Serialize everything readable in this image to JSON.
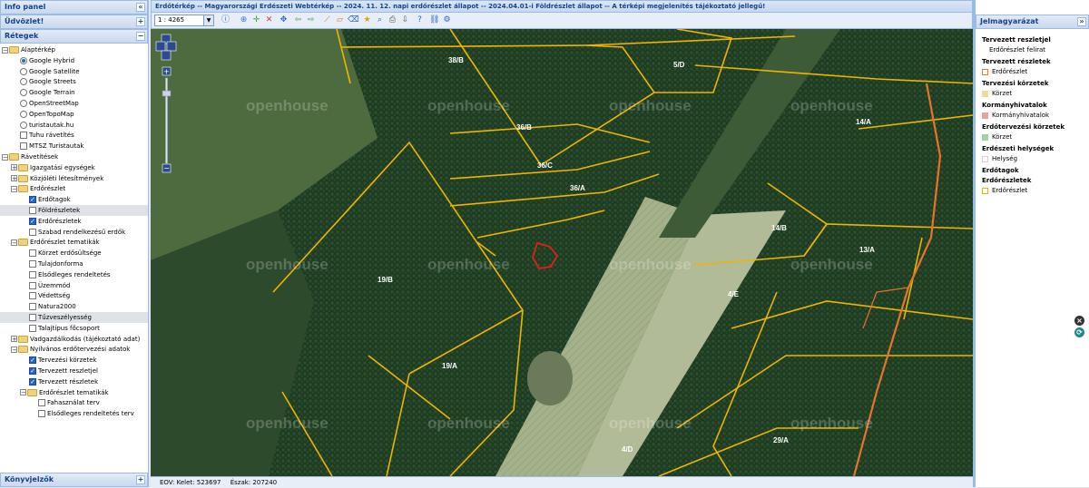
{
  "left_panel": {
    "info_title": "Info panel",
    "welcome_title": "Üdvözlet!",
    "layers_title": "Rétegek",
    "bookmarks_title": "Könyvjelzők",
    "tree": [
      {
        "label": "Alaptérkép",
        "indent": 0,
        "kind": "folder",
        "expanded": true
      },
      {
        "label": "Google Hybrid",
        "indent": 2,
        "kind": "radio",
        "checked": true
      },
      {
        "label": "Google Satellite",
        "indent": 2,
        "kind": "radio",
        "checked": false
      },
      {
        "label": "Google Streets",
        "indent": 2,
        "kind": "radio",
        "checked": false
      },
      {
        "label": "Google Terrain",
        "indent": 2,
        "kind": "radio",
        "checked": false
      },
      {
        "label": "OpenStreetMap",
        "indent": 2,
        "kind": "radio",
        "checked": false
      },
      {
        "label": "OpenTopoMap",
        "indent": 2,
        "kind": "radio",
        "checked": false
      },
      {
        "label": "turistautak.hu",
        "indent": 2,
        "kind": "radio",
        "checked": false
      },
      {
        "label": "Tuhu rávetítés",
        "indent": 2,
        "kind": "checkbox",
        "checked": false
      },
      {
        "label": "MTSZ Turistautak",
        "indent": 2,
        "kind": "checkbox",
        "checked": false
      },
      {
        "label": "Rávetítések",
        "indent": 0,
        "kind": "folder",
        "expanded": true
      },
      {
        "label": "Igazgatási egységek",
        "indent": 1,
        "kind": "folder",
        "expanded": false
      },
      {
        "label": "Közjóléti létesítmények",
        "indent": 1,
        "kind": "folder",
        "expanded": false
      },
      {
        "label": "Erdőrészlet",
        "indent": 1,
        "kind": "folder",
        "expanded": true
      },
      {
        "label": "Erdőtagok",
        "indent": 3,
        "kind": "checkbox",
        "checked": true
      },
      {
        "label": "Földrészletek",
        "indent": 3,
        "kind": "checkbox",
        "checked": false,
        "selected": true
      },
      {
        "label": "Erdőrészletek",
        "indent": 3,
        "kind": "checkbox",
        "checked": true
      },
      {
        "label": "Szabad rendelkezésű erdők",
        "indent": 3,
        "kind": "checkbox",
        "checked": false
      },
      {
        "label": "Erdőrészlet tematikák",
        "indent": 1,
        "kind": "folder",
        "expanded": true
      },
      {
        "label": "Körzet erdősültsége",
        "indent": 3,
        "kind": "checkbox",
        "checked": false
      },
      {
        "label": "Tulajdonforma",
        "indent": 3,
        "kind": "checkbox",
        "checked": false
      },
      {
        "label": "Elsődleges rendeltetés",
        "indent": 3,
        "kind": "checkbox",
        "checked": false
      },
      {
        "label": "Üzemmód",
        "indent": 3,
        "kind": "checkbox",
        "checked": false
      },
      {
        "label": "Védettség",
        "indent": 3,
        "kind": "checkbox",
        "checked": false
      },
      {
        "label": "Natura2000",
        "indent": 3,
        "kind": "checkbox",
        "checked": false
      },
      {
        "label": "Tűzveszélyesség",
        "indent": 3,
        "kind": "checkbox",
        "checked": false,
        "selected": true
      },
      {
        "label": "Talajtípus főcsoport",
        "indent": 3,
        "kind": "checkbox",
        "checked": false
      },
      {
        "label": "Vadgazdálkodás (tájékoztató adat)",
        "indent": 1,
        "kind": "folder",
        "expanded": false
      },
      {
        "label": "Nyilvános erdőtervezési adatok",
        "indent": 1,
        "kind": "folder",
        "expanded": true
      },
      {
        "label": "Tervezési körzetek",
        "indent": 3,
        "kind": "checkbox",
        "checked": true
      },
      {
        "label": "Tervezett reszletjel",
        "indent": 3,
        "kind": "checkbox",
        "checked": true
      },
      {
        "label": "Tervezett részletek",
        "indent": 3,
        "kind": "checkbox",
        "checked": true
      },
      {
        "label": "Erdőrészlet tematikák",
        "indent": 2,
        "kind": "folder",
        "expanded": true
      },
      {
        "label": "Fahasználat terv",
        "indent": 4,
        "kind": "checkbox",
        "checked": false
      },
      {
        "label": "Elsődleges rendeltetés terv",
        "indent": 4,
        "kind": "checkbox",
        "checked": false
      }
    ]
  },
  "main": {
    "title": "Erdőtérkép -- Magyarországi Erdészeti Webtérkép -- 2024. 11. 12. napi erdőrészlet állapot -- 2024.04.01-i Földrészlet állapot -- A térképi megjelenítés tájékoztató jellegű!",
    "scale": "1 : 4265",
    "watermark": "openhouse",
    "status": {
      "kelet_label": "EOV: Kelet:",
      "kelet_value": "523697",
      "eszak_label": "Észak:",
      "eszak_value": "207240"
    },
    "parcels": [
      "38/B",
      "5/D",
      "36/B",
      "14/A",
      "36/C",
      "36/A",
      "14/B",
      "13/A",
      "19/B",
      "4/E",
      "19/A",
      "4/D",
      "29/A"
    ]
  },
  "legend": {
    "title": "Jelmagyarázat",
    "groups": [
      {
        "heading": "Tervezett reszletjel",
        "item": "Erdőrészlet felirat",
        "color": ""
      },
      {
        "heading": "Tervezett részletek",
        "item": "Erdőrészlet",
        "color": "#e07b39"
      },
      {
        "heading": "Tervezési körzetek",
        "item": "Körzet",
        "color": "#f5d79a"
      },
      {
        "heading": "Kormányhivatalok",
        "item": "Kormányhivatalok",
        "color": "#e9a0a0"
      },
      {
        "heading": "Erdőtervezési körzetek",
        "item": "Körzet",
        "color": "#9fd6a0"
      },
      {
        "heading": "Erdészeti helységek",
        "item": "Helység",
        "color": "#f2c6c6"
      },
      {
        "heading": "Erdőtagok",
        "item": "",
        "color": ""
      },
      {
        "heading": "Erdőrészletek",
        "item": "Erdőrészlet",
        "color": "#f0b400"
      }
    ]
  },
  "colors": {
    "accent": "#15428b",
    "border": "#99bbe8",
    "parcel_line": "#f0b400",
    "road": "#e8742a",
    "marker": "#e0201a"
  }
}
